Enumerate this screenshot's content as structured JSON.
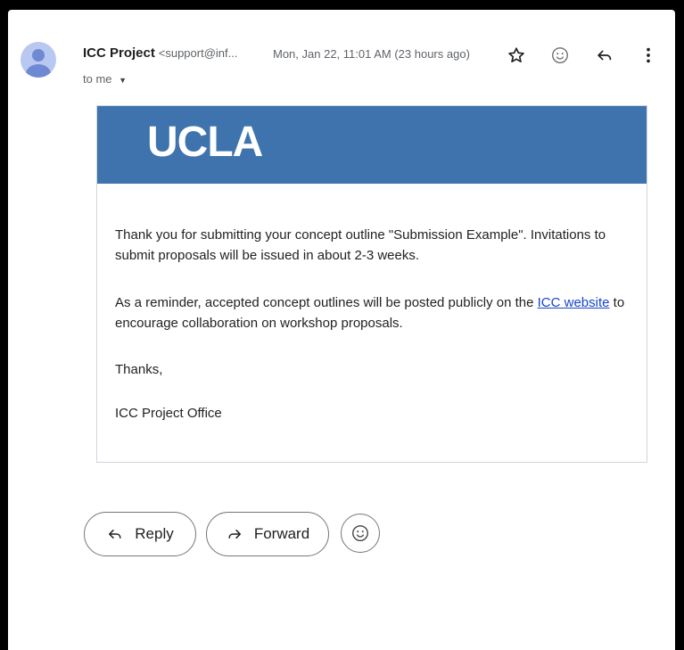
{
  "email": {
    "sender_name": "ICC Project",
    "sender_email": "<support@inf...",
    "date": "Mon, Jan 22, 11:01 AM (23 hours ago)",
    "to_label": "to me",
    "to_caret": "▼"
  },
  "actions": {
    "star_icon": "star-icon",
    "emoji_icon": "emoji-icon",
    "reply_icon": "reply-icon",
    "more_icon": "more-vert-icon"
  },
  "body": {
    "logo_text": "UCLA",
    "banner_color": "#3e73ad",
    "p1": "Thank you for submitting your concept outline \"Submission Example\". Invitations to submit proposals will be issued in about 2-3 weeks.",
    "p2_before": "As a reminder, accepted concept outlines will be posted publicly on the ",
    "p2_link": "ICC website",
    "p2_after": " to encourage collaboration on workshop proposals.",
    "p3": "Thanks,",
    "p4": "ICC Project Office"
  },
  "footer": {
    "reply_label": "Reply",
    "forward_label": "Forward"
  }
}
